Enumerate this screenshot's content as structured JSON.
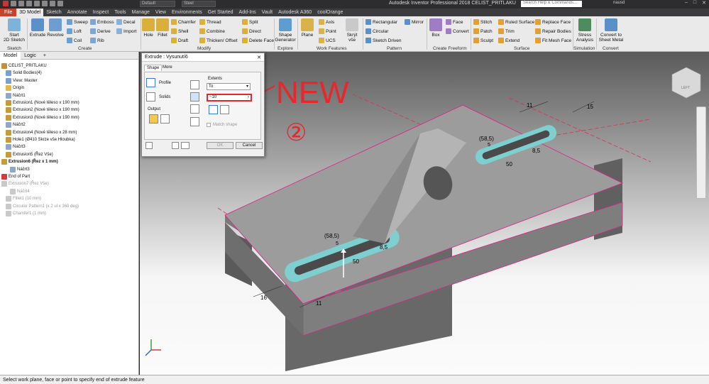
{
  "titlebar": {
    "title": "Autodesk Inventor Professional 2018   CELIST_PRITLAKU",
    "appearance": "Default",
    "material": "Steel",
    "search_placeholder": "Search Help & Commands...",
    "user": "nausd"
  },
  "tabs": [
    "File",
    "3D Model",
    "Sketch",
    "Annotate",
    "Inspect",
    "Tools",
    "Manage",
    "View",
    "Environments",
    "Get Started",
    "Add-Ins",
    "Vault",
    "Autodesk A360",
    "coolOrange"
  ],
  "ribbon": {
    "sketch": {
      "start": "Start\n2D Sketch",
      "group": "Sketch"
    },
    "create": {
      "extrude": "Extrude",
      "revolve": "Revolve",
      "sweep": "Sweep",
      "loft": "Loft",
      "coil": "Coil",
      "emboss": "Emboss",
      "derive": "Derive",
      "rib": "Rib",
      "decal": "Decal",
      "import": "Import",
      "group": "Create"
    },
    "modify": {
      "hole": "Hole",
      "fillet": "Fillet",
      "chamfer": "Chamfer",
      "shell": "Shell",
      "draft": "Draft",
      "thread": "Thread",
      "combine": "Combine",
      "thicken": "Thicken/ Offset",
      "split": "Split",
      "direct": "Direct",
      "delete_face": "Delete Face",
      "group": "Modify"
    },
    "explore": {
      "shape_gen": "Shape\nGenerator",
      "group": "Explore"
    },
    "work": {
      "plane": "Plane",
      "axis": "Axis",
      "point": "Point",
      "ucs": "UCS",
      "hide": "Skrýt vše",
      "group": "Work Features"
    },
    "pattern": {
      "rectangular": "Rectangular",
      "circular": "Circular",
      "sketch_driven": "Sketch Driven",
      "mirror": "Mirror",
      "group": "Pattern"
    },
    "freeform": {
      "box": "Box",
      "face": "Face",
      "convert": "Convert",
      "group": "Create Freeform"
    },
    "surface": {
      "stitch": "Stitch",
      "patch": "Patch",
      "sculpt": "Sculpt",
      "trim": "Trim",
      "extend": "Extend",
      "ruled": "Ruled Surface",
      "replace": "Replace Face",
      "repair": "Repair Bodies",
      "fitmesh": "Fit Mesh Face",
      "group": "Surface"
    },
    "simulation": {
      "stress": "Stress\nAnalysis",
      "group": "Simulation"
    },
    "convert": {
      "sheetmetal": "Convert to\nSheet Metal",
      "group": "Convert"
    }
  },
  "browser": {
    "tabs": [
      "Model",
      "Logic",
      "+"
    ],
    "items": [
      {
        "label": "CELIST_PRITLAKU",
        "state": "normal"
      },
      {
        "label": "Solid Bodies(4)",
        "state": "normal"
      },
      {
        "label": "View: Master",
        "state": "normal"
      },
      {
        "label": "Origin",
        "state": "normal"
      },
      {
        "label": "Náčrt1",
        "state": "normal"
      },
      {
        "label": "Extrusion1 (Nové těleso x 190 mm)",
        "state": "normal"
      },
      {
        "label": "Extrusion2 (Nové těleso x 190 mm)",
        "state": "normal"
      },
      {
        "label": "Extrusion3 (Nové těleso x 190 mm)",
        "state": "normal"
      },
      {
        "label": "Náčrt2",
        "state": "normal"
      },
      {
        "label": "Extrusion4 (Nové těleso x 28 mm)",
        "state": "normal"
      },
      {
        "label": "Hole1 (Ø410 Skrze vše Hloubka)",
        "state": "normal"
      },
      {
        "label": "Náčrt3",
        "state": "normal"
      },
      {
        "label": "Extrusion5 (Řez Vše)",
        "state": "normal"
      },
      {
        "label": "Extrusion6 (Řez x 1 mm)",
        "state": "bold"
      },
      {
        "label": "Náčrt3",
        "state": "normal"
      },
      {
        "label": "End of Part",
        "state": "normal"
      },
      {
        "label": "Extrusion7 (Řez Vše)",
        "state": "dim"
      },
      {
        "label": "Náčrt4",
        "state": "dim"
      },
      {
        "label": "Fillet1 (10 mm)",
        "state": "dim"
      },
      {
        "label": "Circular Pattern1 (x 2 ul x 360 deg)",
        "state": "dim"
      },
      {
        "label": "Chamfer1 (1 mm)",
        "state": "dim"
      }
    ]
  },
  "dialog": {
    "title": "Extrude : Vysunutí6",
    "tabs": [
      "Shape",
      "More"
    ],
    "profile": "Profile",
    "solids": "Solids",
    "output": "Output",
    "extents": "Extents",
    "extents_value": "To",
    "distance_value": "~10",
    "match_shape": "Match shape",
    "ok": "OK",
    "cancel": "Cancel"
  },
  "annotation": {
    "text": "NEW",
    "number": "②",
    "color": "#e8262b"
  },
  "dims": {
    "d11a": "11",
    "d15": "15",
    "d58a": "(58,5)",
    "d5a": "5",
    "d85a": "8,5",
    "d50a": "50",
    "d58b": "(58,5)",
    "d5b": "5",
    "d85b": "8,5",
    "d50b": "50",
    "d16": "16",
    "d11b": "11"
  },
  "viewcube": {
    "face": "LEFT"
  },
  "status": "Select work plane, face or point to specify end of extrude feature",
  "colors": {
    "accent": "#c8412b",
    "highlight": "#e01f8a",
    "slot": "#7ecfd0"
  }
}
